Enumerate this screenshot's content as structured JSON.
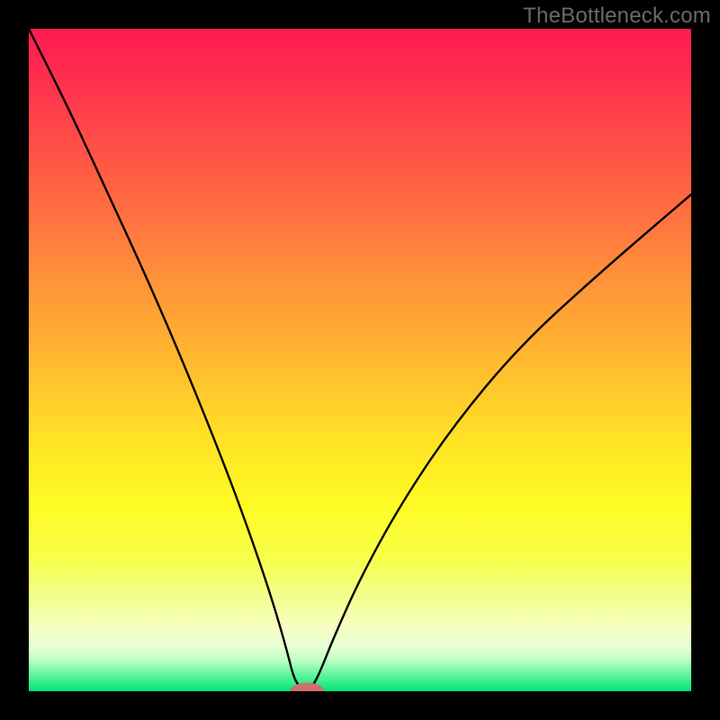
{
  "watermark": "TheBottleneck.com",
  "colors": {
    "frame": "#000000",
    "watermark_text": "#6a6a6a",
    "curve": "#000000",
    "marker_fill": "#cf6f6b",
    "marker_stroke": "#cf6f6b",
    "gradient_stops": [
      {
        "offset": 0.0,
        "color": "#ff1a52"
      },
      {
        "offset": 0.06,
        "color": "#ff2a4f"
      },
      {
        "offset": 0.16,
        "color": "#ff4a48"
      },
      {
        "offset": 0.28,
        "color": "#ff7040"
      },
      {
        "offset": 0.4,
        "color": "#ff9938"
      },
      {
        "offset": 0.52,
        "color": "#ffbf2e"
      },
      {
        "offset": 0.62,
        "color": "#ffe225"
      },
      {
        "offset": 0.72,
        "color": "#fffb24"
      },
      {
        "offset": 0.8,
        "color": "#f7ff4a"
      },
      {
        "offset": 0.86,
        "color": "#f2ff90"
      },
      {
        "offset": 0.905,
        "color": "#f6ffc4"
      },
      {
        "offset": 0.935,
        "color": "#e6ffd4"
      },
      {
        "offset": 0.955,
        "color": "#b8ffc0"
      },
      {
        "offset": 0.975,
        "color": "#60f59a"
      },
      {
        "offset": 1.0,
        "color": "#00e47a"
      }
    ]
  },
  "chart_data": {
    "type": "line",
    "title": "",
    "xlabel": "",
    "ylabel": "",
    "xlim": [
      0,
      100
    ],
    "ylim": [
      0,
      100
    ],
    "series": [
      {
        "name": "bottleneck-curve",
        "x": [
          0,
          6,
          12,
          18,
          24,
          30,
          34,
          37,
          39,
          40,
          41,
          42,
          43,
          44,
          46,
          50,
          56,
          64,
          74,
          86,
          100
        ],
        "values": [
          100,
          88,
          75,
          62,
          48,
          33,
          22,
          13,
          6,
          2,
          0.5,
          0,
          1,
          3,
          8,
          17,
          28,
          40,
          52,
          63,
          75
        ]
      }
    ],
    "marker": {
      "x": 42,
      "y": 0,
      "rx": 2.5,
      "ry": 1.2
    }
  }
}
